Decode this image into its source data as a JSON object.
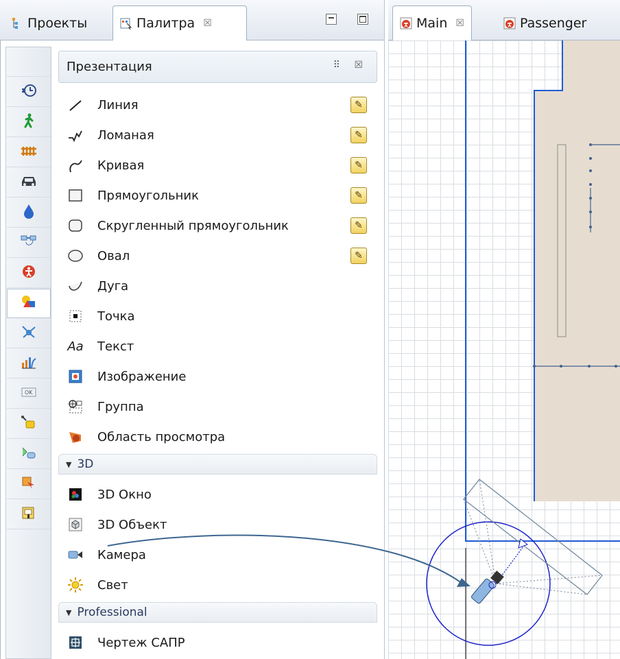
{
  "left_panel": {
    "tabs": [
      {
        "label": "Проекты",
        "icon": "projects-icon"
      },
      {
        "label": "Палитра",
        "icon": "palette-icon",
        "close": "☒"
      }
    ],
    "window_buttons": [
      "minimize",
      "maximize"
    ]
  },
  "category_bar": {
    "items": [
      {
        "icon": "blank"
      },
      {
        "icon": "process-modeling-icon"
      },
      {
        "icon": "pedestrian-icon"
      },
      {
        "icon": "rail-icon"
      },
      {
        "icon": "car-icon"
      },
      {
        "icon": "fluid-drop-icon"
      },
      {
        "icon": "system-dynamics-icon"
      },
      {
        "icon": "agent-icon"
      },
      {
        "icon": "presentation-icon",
        "selected": true
      },
      {
        "icon": "space-markup-icon"
      },
      {
        "icon": "analysis-icon"
      },
      {
        "icon": "controls-icon"
      },
      {
        "icon": "connectivity-icon"
      },
      {
        "icon": "statechart-icon"
      },
      {
        "icon": "actions-icon"
      },
      {
        "icon": "pictures-icon"
      }
    ]
  },
  "palette": {
    "section_title": "Презентация",
    "section_controls": "⠿ ☒",
    "items": [
      {
        "label": "Линия",
        "icon": "line-icon",
        "pencil": true
      },
      {
        "label": "Ломаная",
        "icon": "polyline-icon",
        "pencil": true
      },
      {
        "label": "Кривая",
        "icon": "curve-icon",
        "pencil": true
      },
      {
        "label": "Прямоугольник",
        "icon": "rectangle-icon",
        "pencil": true
      },
      {
        "label": "Скругленный прямоугольник",
        "icon": "rounded-rectangle-icon",
        "pencil": true
      },
      {
        "label": "Овал",
        "icon": "oval-icon",
        "pencil": true
      },
      {
        "label": "Дуга",
        "icon": "arc-icon",
        "pencil": false
      },
      {
        "label": "Точка",
        "icon": "point-icon",
        "pencil": false
      },
      {
        "label": "Текст",
        "icon": "text-icon",
        "icon_text": "Aa",
        "pencil": false
      },
      {
        "label": "Изображение",
        "icon": "image-icon",
        "pencil": false
      },
      {
        "label": "Группа",
        "icon": "group-icon",
        "pencil": false
      },
      {
        "label": "Область просмотра",
        "icon": "view-area-icon",
        "pencil": false
      }
    ],
    "group_3d": {
      "title": "3D",
      "items": [
        {
          "label": "3D Окно",
          "icon": "3d-window-icon"
        },
        {
          "label": "3D Объект",
          "icon": "3d-object-icon"
        },
        {
          "label": "Камера",
          "icon": "camera-icon"
        },
        {
          "label": "Свет",
          "icon": "light-icon"
        }
      ]
    },
    "group_professional": {
      "title": "Professional",
      "items": [
        {
          "label": "Чертеж САПР",
          "icon": "cad-drawing-icon"
        }
      ]
    }
  },
  "editor": {
    "tabs": [
      {
        "label": "Main",
        "icon": "agent-icon",
        "close": "☒"
      },
      {
        "label": "Passenger",
        "icon": "agent-icon"
      }
    ]
  },
  "colors": {
    "canvas_grid": "#d9dde2",
    "wall_blue": "#1f5bd4",
    "floor_beige": "#e6ddd0",
    "arrow": "#3d6690"
  }
}
